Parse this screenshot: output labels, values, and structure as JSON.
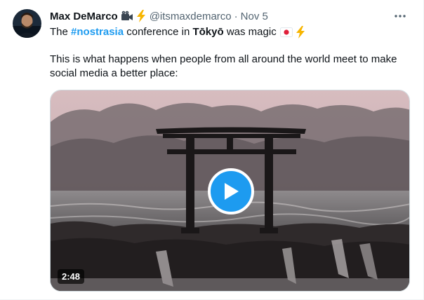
{
  "tweet": {
    "author": {
      "display_name": "Max DeMarco",
      "handle": "@itsmaxdemarco",
      "separator": "·",
      "timestamp": "Nov 5",
      "badges": [
        "movie-camera-icon",
        "lightning-icon"
      ]
    },
    "text": {
      "prefix": "The",
      "hashtag": "#nostrasia",
      "middle": "conference in",
      "bold_word": "Tōkyō",
      "suffix": "was magic",
      "emojis": [
        "japan-flag-icon",
        "lightning-icon"
      ],
      "paragraph2": "This is what happens when people from all around the world meet to make social media a better place:"
    },
    "media": {
      "type": "video",
      "duration": "2:48",
      "description_icon": "torii-gate-image"
    },
    "colors": {
      "accent": "#1d9bf0",
      "text_primary": "#0f1419",
      "text_secondary": "#536471"
    }
  }
}
